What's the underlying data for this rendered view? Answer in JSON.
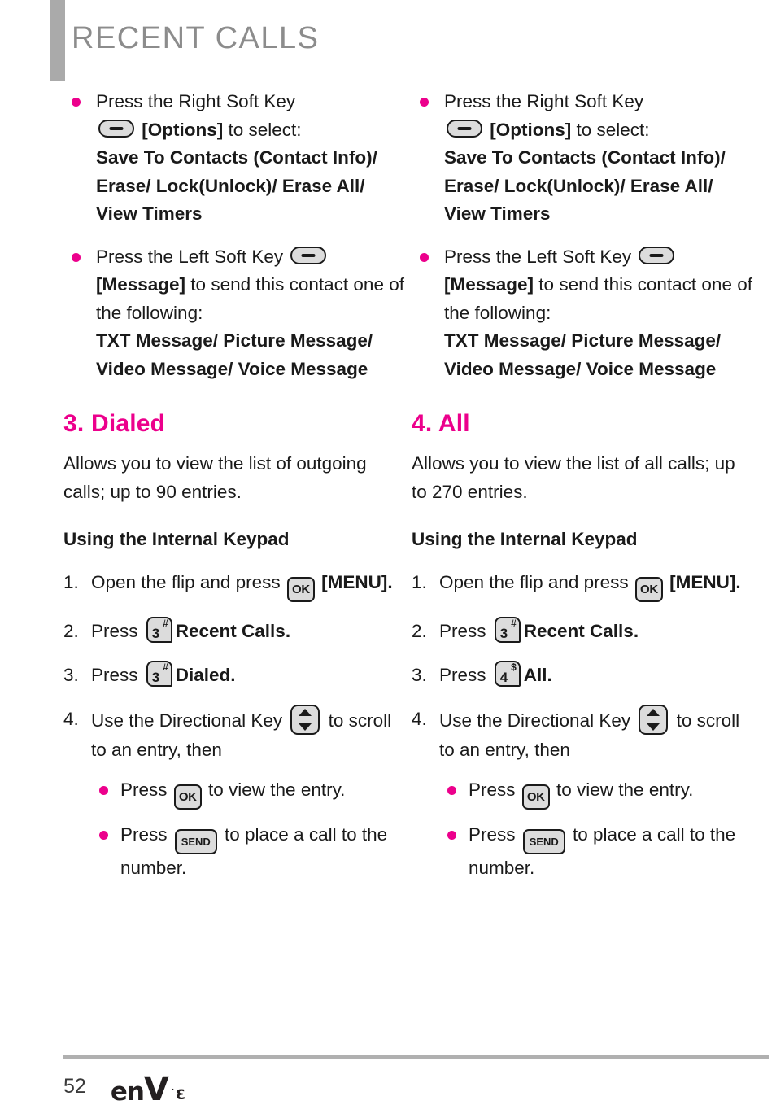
{
  "header": {
    "title": "RECENT CALLS",
    "accent_gray": "#aaaaaa",
    "title_color": "#8c8c8c"
  },
  "colors": {
    "accent_magenta": "#ec008c",
    "key_fill": "#dcdcdc",
    "text": "#1a1a1a"
  },
  "icons": {
    "soft_key": "soft-key-icon",
    "ok_key_label": "OK",
    "send_key_label": "SEND",
    "key3_digit": "3",
    "key3_symbol": "#",
    "key4_digit": "4",
    "key4_symbol": "$",
    "dir_key": "directional-key-icon"
  },
  "left_column": {
    "top_bullets": [
      {
        "line1": "Press the Right Soft Key",
        "after_icon": "[Options]",
        "after_icon_tail": " to select:",
        "bold_body": "Save To Contacts (Contact Info)/ Erase/ Lock(Unlock)/ Erase All/ View Timers"
      },
      {
        "line1": "Press the Left Soft Key",
        "after_icon": "[Message]",
        "after_icon_tail": " to send this contact one of the following:",
        "bold_body": "TXT Message/ Picture Message/ Video Message/ Voice Message"
      }
    ],
    "section": {
      "heading": "3. Dialed",
      "description": "Allows you to view the list of outgoing calls; up to 90 entries.",
      "subheading": "Using the Internal Keypad",
      "steps": [
        {
          "num": "1.",
          "pre": "Open the flip and press ",
          "key": "ok",
          "post": " [MENU].",
          "post_bold": ""
        },
        {
          "num": "2.",
          "pre": "Press ",
          "key": "num3",
          "post": " ",
          "post_bold": "Recent Calls."
        },
        {
          "num": "3.",
          "pre": "Press ",
          "key": "num3",
          "post": " ",
          "post_bold": "Dialed."
        },
        {
          "num": "4.",
          "pre": "Use the Directional Key ",
          "key": "dir",
          "post": " to scroll to an entry, then",
          "post_bold": ""
        }
      ],
      "substeps": [
        {
          "pre": "Press ",
          "key": "ok",
          "post": " to view the entry."
        },
        {
          "pre": "Press ",
          "key": "send",
          "post": " to place a call to the number."
        }
      ]
    }
  },
  "right_column": {
    "top_bullets": [
      {
        "line1": "Press the Right Soft Key",
        "after_icon": "[Options]",
        "after_icon_tail": " to select:",
        "bold_body": "Save To Contacts (Contact Info)/ Erase/ Lock(Unlock)/ Erase All/ View Timers"
      },
      {
        "line1": "Press the Left Soft Key",
        "after_icon": "[Message]",
        "after_icon_tail": " to send this contact one of the following:",
        "bold_body": "TXT Message/ Picture Message/ Video Message/ Voice Message"
      }
    ],
    "section": {
      "heading": "4. All",
      "description": "Allows you to view the list of all calls; up to 270 entries.",
      "subheading": "Using the Internal Keypad",
      "steps": [
        {
          "num": "1.",
          "pre": "Open the flip and press ",
          "key": "ok",
          "post": " [MENU].",
          "post_bold": ""
        },
        {
          "num": "2.",
          "pre": "Press ",
          "key": "num3",
          "post": " ",
          "post_bold": "Recent Calls."
        },
        {
          "num": "3.",
          "pre": "Press ",
          "key": "num4",
          "post": " ",
          "post_bold": "All."
        },
        {
          "num": "4.",
          "pre": "Use the Directional Key ",
          "key": "dir",
          "post": " to scroll to an entry, then",
          "post_bold": ""
        }
      ],
      "substeps": [
        {
          "pre": "Press ",
          "key": "ok",
          "post": " to view the entry."
        },
        {
          "pre": "Press ",
          "key": "send",
          "post": " to place a call to the number."
        }
      ]
    }
  },
  "footer": {
    "page_number": "52",
    "logo_en": "en",
    "logo_v": "V",
    "logo_dot": "˙",
    "logo_three": "3"
  }
}
